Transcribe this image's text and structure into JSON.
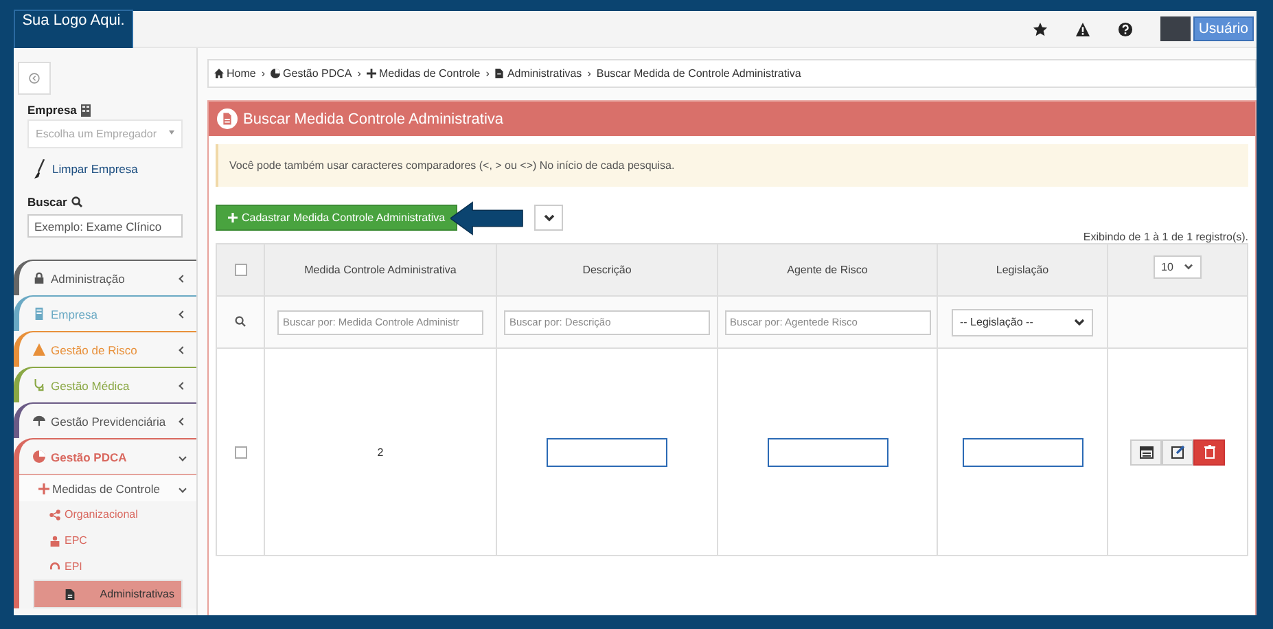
{
  "header": {
    "logo": "Sua Logo Aqui.",
    "user_button": "Usuário"
  },
  "sidebar": {
    "company_label": "Empresa",
    "company_placeholder": "Escolha um Empregador",
    "clear_company": "Limpar Empresa",
    "search_label": "Buscar",
    "search_placeholder": "Exemplo: Exame Clínico",
    "menu": [
      {
        "label": "Administração",
        "color": "#666666",
        "expanded": false
      },
      {
        "label": "Empresa",
        "color": "#6aa9c4",
        "expanded": false
      },
      {
        "label": "Gestão de Risco",
        "color": "#e8903a",
        "expanded": false
      },
      {
        "label": "Gestão Médica",
        "color": "#8aa845",
        "expanded": false
      },
      {
        "label": "Gestão Previdenciária",
        "color": "#6b5b86",
        "expanded": false
      },
      {
        "label": "Gestão PDCA",
        "color": "#d9685f",
        "expanded": true,
        "children": [
          {
            "label": "Medidas de Controle",
            "expanded": true,
            "children": [
              {
                "label": "Organizacional",
                "selected": false
              },
              {
                "label": "EPC",
                "selected": false
              },
              {
                "label": "EPI",
                "selected": false
              },
              {
                "label": "Administrativas",
                "selected": true
              }
            ]
          }
        ]
      }
    ]
  },
  "breadcrumb": [
    {
      "label": "Home"
    },
    {
      "separator": "›",
      "label": "Gestão PDCA"
    },
    {
      "separator": "›",
      "label": "Medidas de Controle"
    },
    {
      "separator": "›",
      "label": "Administrativas"
    },
    {
      "separator": "›",
      "label": "Buscar Medida de Controle Administrativa"
    }
  ],
  "panel": {
    "title": "Buscar Medida Controle Administrativa",
    "alert": "Você pode também usar caracteres comparadores (<, > ou <>) No início de cada pesquisa.",
    "add_button": "Cadastrar Medida Controle Administrativa",
    "records_info": "Exibindo de 1 à 1 de 1 registro(s).",
    "page_size": "10",
    "table": {
      "select_all_checked": false,
      "columns": [
        "Medida Controle Administrativa",
        "Descrição",
        "Agente de Risco",
        "Legislação"
      ],
      "filters": [
        {
          "kind": "text",
          "placeholder": "Buscar por: Medida Controle Administr"
        },
        {
          "kind": "text",
          "placeholder": "Buscar por: Descrição"
        },
        {
          "kind": "text",
          "placeholder": "Buscar por: Agentede Risco"
        },
        {
          "kind": "select",
          "value": "-- Legislação --"
        }
      ],
      "rows": [
        {
          "checked": false,
          "cells": [
            {
              "text": "2",
              "highlighted": false
            },
            {
              "highlighted": true
            },
            {
              "highlighted": true
            },
            {
              "highlighted": true
            }
          ]
        }
      ]
    }
  }
}
